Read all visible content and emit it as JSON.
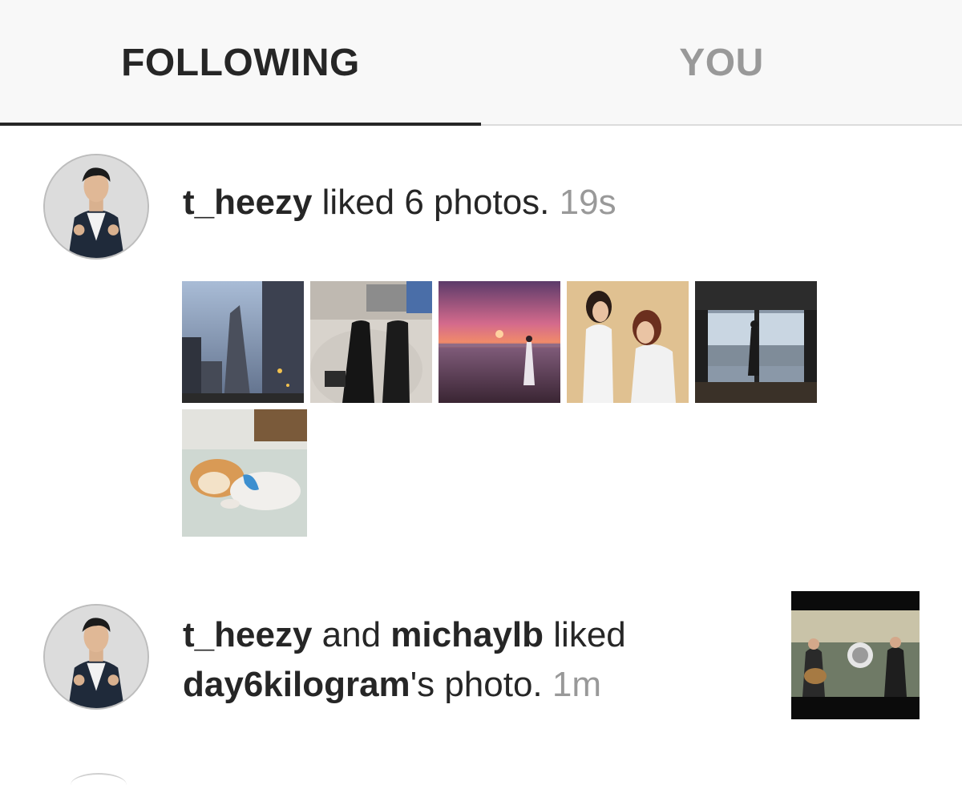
{
  "tabs": {
    "following": "FOLLOWING",
    "you": "YOU"
  },
  "activity": [
    {
      "user": "t_heezy",
      "action": " liked 6 photos. ",
      "time": "19s"
    },
    {
      "user1": "t_heezy",
      "connector": " and ",
      "user2": "michaylb",
      "action": " liked",
      "target": "day6kilogram",
      "suffix": "'s photo. ",
      "time": "1m"
    }
  ],
  "colors": {
    "text": "#262626",
    "muted": "#999999",
    "tabbar_bg": "#f8f8f8"
  }
}
